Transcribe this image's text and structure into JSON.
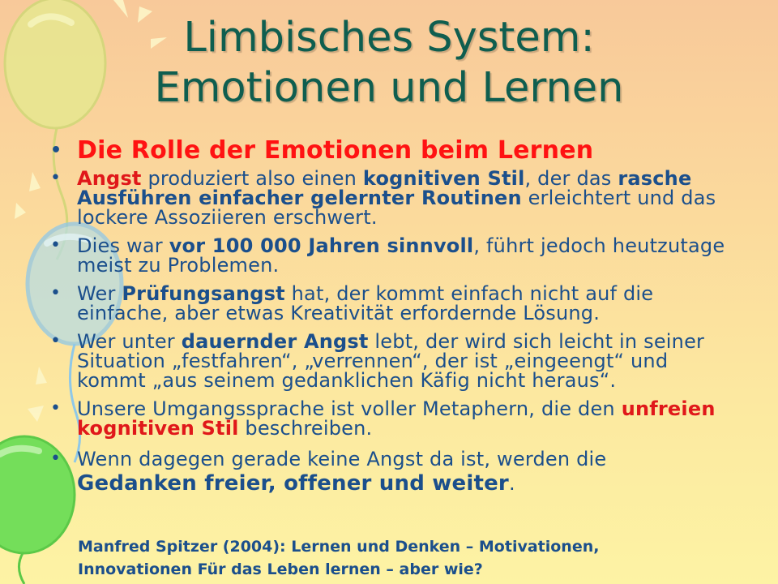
{
  "slide": {
    "title_line1": "Limbisches System:",
    "title_line2": "Emotionen und Lernen",
    "heading": "Die Rolle der Emotionen beim Lernen",
    "b1": {
      "t1": "Angst",
      "t2": " produziert also einen ",
      "t3": "kognitiven Stil",
      "t4": ", der das ",
      "t5": "rasche Ausführen einfacher gelernter Routinen",
      "t6": " erleichtert und das lockere Assoziieren erschwert."
    },
    "b2": {
      "t1": "Dies war ",
      "t2": "vor 100 000 Jahren sinnvoll",
      "t3": ", führt jedoch heutzutage meist zu Problemen."
    },
    "b3": {
      "t1": "Wer ",
      "t2": "Prüfungsangst",
      "t3": " hat, der kommt einfach nicht auf die einfache, aber etwas Kreativität erfordernde Lösung."
    },
    "b4": {
      "t1": "Wer unter ",
      "t2": "dauernder Angst",
      "t3": " lebt, der wird sich leicht in seiner Situation „festfahren“, „verrennen“, der ist „eingeengt“ und kommt „aus seinem gedanklichen Käfig nicht heraus“."
    },
    "b5": {
      "t1": "Unsere Umgangssprache ist voller Metaphern, die den ",
      "t2": "unfreien kognitiven Stil",
      "t3": " beschreiben."
    },
    "b6": {
      "t1": "Wenn dagegen gerade keine Angst da ist, werden die ",
      "t2": "Gedanken freier, offener und weiter",
      "t3": "."
    },
    "citation_line1": "Manfred Spitzer (2004): Lernen und Denken – Motivationen,",
    "citation_line2": "Innovationen Für das Leben lernen – aber wie?"
  },
  "colors": {
    "title": "#0f5e4f",
    "body_text": "#1b4f8c",
    "emphasis_red": "#e0181a",
    "heading_red": "#ff1212"
  },
  "icons": [
    "balloon-yellow",
    "balloon-blue",
    "balloon-green",
    "sun-rays"
  ]
}
